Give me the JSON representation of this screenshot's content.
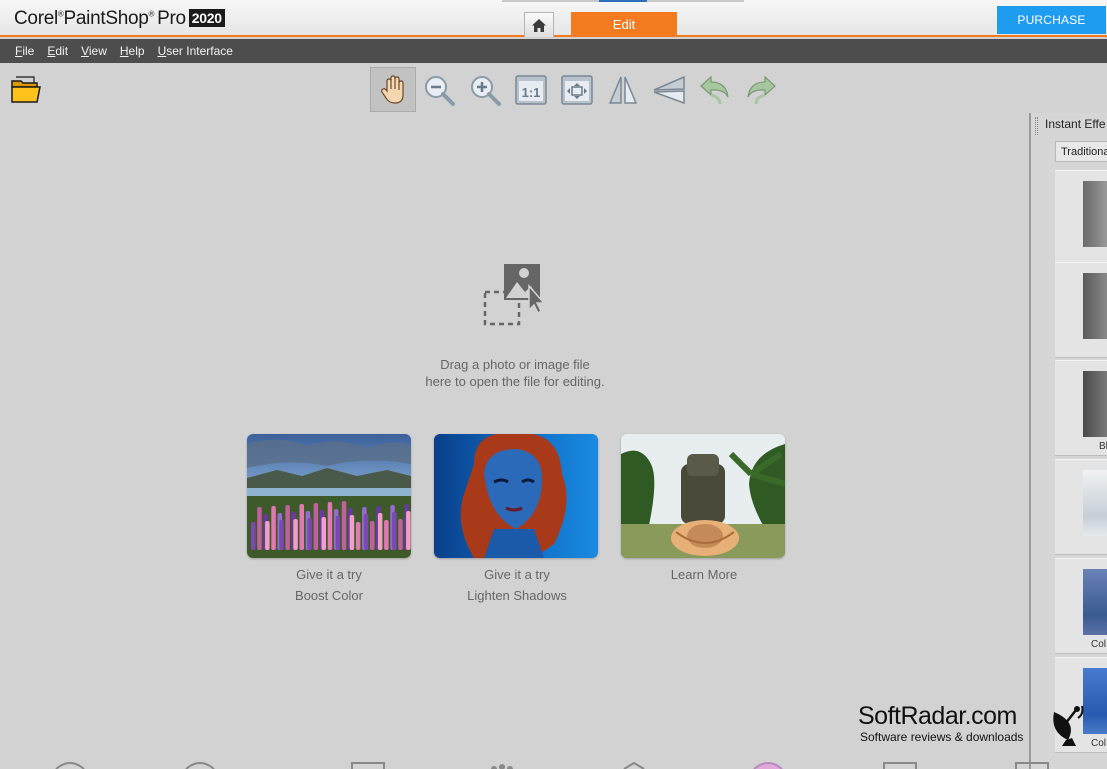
{
  "app": {
    "brand": "Corel",
    "product": "PaintShop",
    "edition": "Pro",
    "year": "2020"
  },
  "tabs": {
    "home_icon": "home-icon",
    "edit_label": "Edit"
  },
  "purchase_label": "PURCHASE",
  "menu": [
    "File",
    "Edit",
    "View",
    "Help",
    "User Interface"
  ],
  "toolbar": {
    "icons": [
      "pan-hand-icon",
      "zoom-out-icon",
      "zoom-in-icon",
      "actual-size-icon",
      "fit-to-window-icon",
      "flip-horizontal-icon",
      "flip-vertical-icon",
      "undo-icon",
      "redo-icon"
    ],
    "active": "pan-hand-icon"
  },
  "workspace": {
    "drop_line1": "Drag a photo or image file",
    "drop_line2": "here to open the file for editing.",
    "cards": [
      {
        "line1": "Give it a try",
        "line2": "Boost Color"
      },
      {
        "line1": "Give it a try",
        "line2": "Lighten Shadows"
      },
      {
        "line1": "Learn More",
        "line2": ""
      }
    ]
  },
  "instant_effects": {
    "title": "Instant Effe",
    "dropdown_value": "Traditional",
    "items": [
      {
        "label": ""
      },
      {
        "label": ""
      },
      {
        "label": "Bl"
      },
      {
        "label": ""
      },
      {
        "label": "Col"
      },
      {
        "label": "Col"
      }
    ]
  },
  "watermark": {
    "title": "SoftRadar.com",
    "subtitle": "Software reviews & downloads"
  },
  "colors": {
    "accent_orange": "#f47a1f",
    "purchase_blue": "#1e9cf0",
    "menubar": "#4d4d4d",
    "workspace": "#d2d2d2"
  }
}
